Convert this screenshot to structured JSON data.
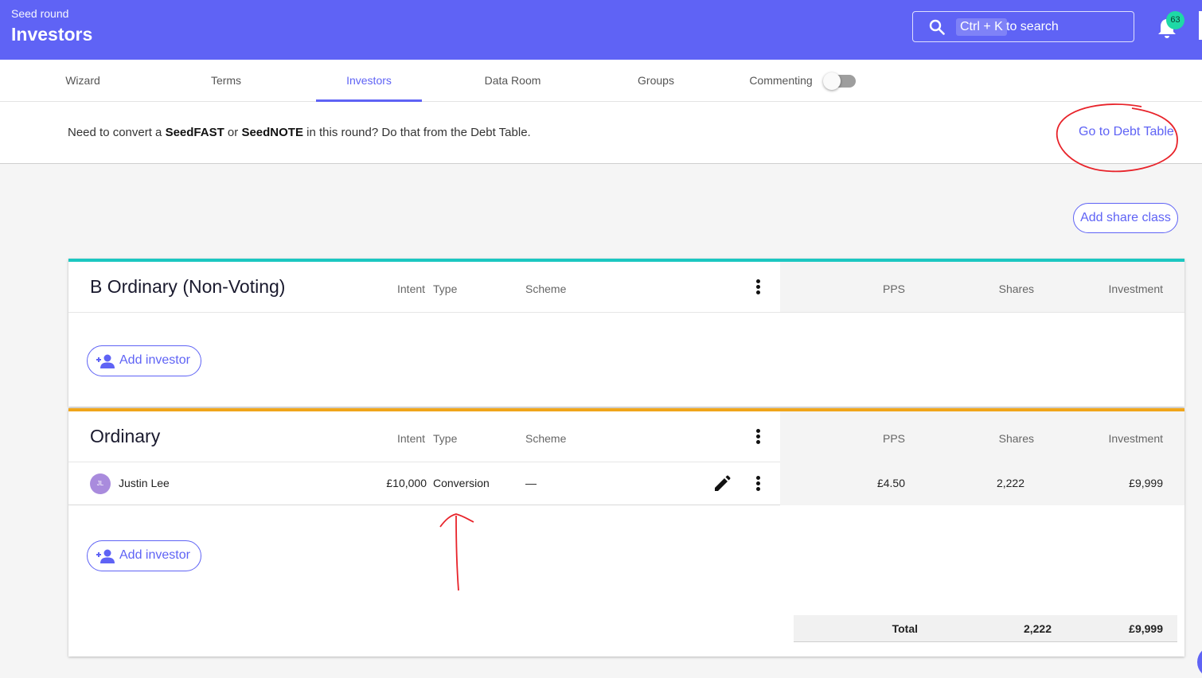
{
  "header": {
    "pre_title": "Seed round",
    "title": "Investors",
    "search": {
      "shortcut": "Ctrl + K",
      "placeholder": "to search",
      "icon": "search-icon"
    },
    "notifications": {
      "count": "63",
      "icon": "bell-icon",
      "badge_color": "#1ed9a6"
    },
    "accent": "#5f63f5"
  },
  "tabs": [
    {
      "label": "Wizard"
    },
    {
      "label": "Terms"
    },
    {
      "label": "Investors",
      "active": true
    },
    {
      "label": "Data Room"
    },
    {
      "label": "Groups"
    },
    {
      "label": "Commenting",
      "toggle": "off"
    }
  ],
  "notice": {
    "text_1": "Need to convert a ",
    "bold_1": "SeedFAST",
    "text_2": " or ",
    "bold_2": "SeedNOTE",
    "text_3": " in this round? Do that from the Debt Table.",
    "link": "Go to Debt Table"
  },
  "actions": {
    "add_share_class": "Add share class"
  },
  "columns": {
    "intent": "Intent",
    "type": "Type",
    "scheme": "Scheme",
    "pps": "PPS",
    "shares": "Shares",
    "investment": "Investment"
  },
  "share_classes": [
    {
      "name": "B Ordinary (Non-Voting)",
      "color": "#1cc7c1",
      "add_investor": "Add investor",
      "investors": []
    },
    {
      "name": "Ordinary",
      "color": "#f0a51a",
      "add_investor": "Add investor",
      "investors": [
        {
          "initials": "JL",
          "name": "Justin Lee",
          "intent": "£10,000",
          "type": "Conversion",
          "scheme": "—",
          "pps": "£4.50",
          "shares": "2,222",
          "investment": "£9,999"
        }
      ],
      "total": {
        "label": "Total",
        "shares": "2,222",
        "investment": "£9,999"
      }
    }
  ]
}
